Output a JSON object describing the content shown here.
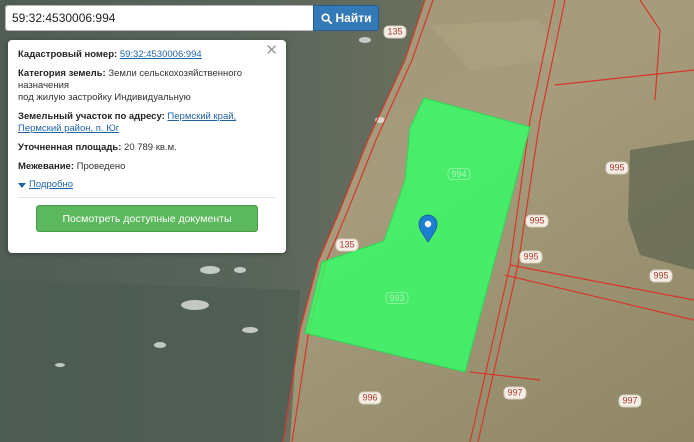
{
  "search": {
    "value": "59:32:4530006:994",
    "button_label": "Найти",
    "button_icon": "search-icon"
  },
  "popup": {
    "close_icon": "close-icon",
    "cadastral_label": "Кадастровый номер:",
    "cadastral_value": "59:32:4530006:994",
    "category_label": "Категория земель:",
    "category_value_line1": "Земли сельскохозяйственного",
    "category_value_line2": "назначения",
    "category_value_line3": "под жилую застройку Индивидуальную",
    "address_label": "Земельный участок по адресу:",
    "address_value_line1": "Пермский край,",
    "address_value_line2": "Пермский район, п. Юг",
    "area_label": "Уточненная площадь:",
    "area_value": "20 789 кв.м.",
    "survey_label": "Межевание:",
    "survey_value": "Проведено",
    "details_link": "Подробно",
    "docs_button": "Посмотреть доступные документы"
  },
  "map": {
    "parcel_labels": [
      "135",
      "135",
      "995",
      "995",
      "995",
      "995",
      "996",
      "997",
      "997"
    ],
    "faint_labels": [
      "994",
      "993"
    ],
    "colors": {
      "selected_parcel": "#33ff66",
      "boundary": "#d9362a",
      "label_text": "#b23a2e",
      "marker": "#1e7fd1"
    },
    "marker_icon": "map-pin-icon"
  }
}
